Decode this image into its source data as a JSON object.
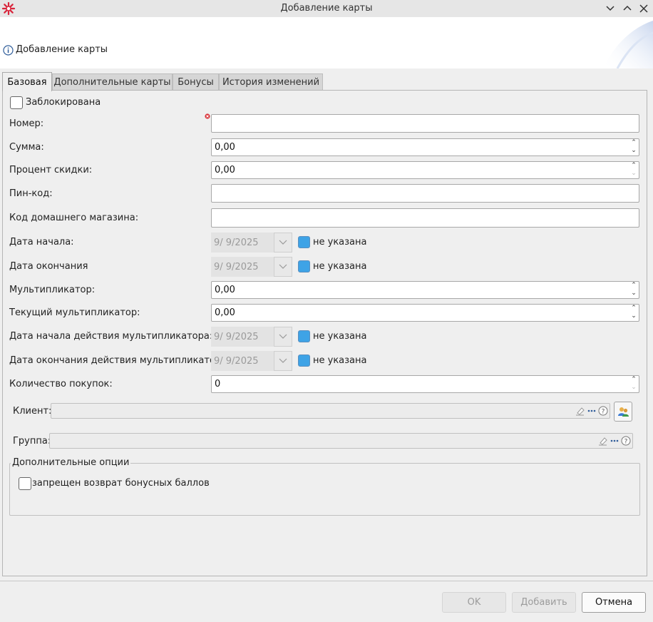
{
  "window": {
    "title": "Добавление карты"
  },
  "header": {
    "title": "Добавление карты"
  },
  "tabs": [
    {
      "label": "Базовая",
      "active": true
    },
    {
      "label": "Дополнительные карты",
      "active": false
    },
    {
      "label": "Бонусы",
      "active": false
    },
    {
      "label": "История изменений",
      "active": false
    }
  ],
  "form": {
    "blocked_label": "Заблокирована",
    "number_label": "Номер:",
    "number_value": "",
    "sum_label": "Сумма:",
    "sum_value": "0,00",
    "discount_label": "Процент скидки:",
    "discount_value": "0,00",
    "pin_label": "Пин-код:",
    "pin_value": "",
    "home_store_label": "Код домашнего магазина:",
    "home_store_value": "",
    "start_date_label": "Дата начала:",
    "start_date_value": "9/ 9/2025",
    "end_date_label": "Дата окончания",
    "end_date_value": "9/ 9/2025",
    "not_specified_label": "не указана",
    "multiplier_label": "Мультипликатор:",
    "multiplier_value": "0,00",
    "current_multiplier_label": "Текущий мультипликатор:",
    "current_multiplier_value": "0,00",
    "mult_start_label": "Дата начала действия мультипликатора:",
    "mult_start_value": "9/ 9/2025",
    "mult_end_label": "Дата окончания действия мультипликатора:",
    "mult_end_value": "9/ 9/2025",
    "purchases_label": "Количество покупок:",
    "purchases_value": "0",
    "client_label": "Клиент:",
    "client_value": "",
    "group_label": "Группа:",
    "group_value": ""
  },
  "options": {
    "title": "Дополнительные опции",
    "no_bonus_return_label": "запрещен возврат бонусных баллов"
  },
  "buttons": {
    "ok": "OK",
    "add": "Добавить",
    "cancel": "Отмена"
  },
  "colors": {
    "accent_checkbox": "#3ea3e6",
    "required_marker": "#d9343a",
    "app_icon": "#d9263c"
  }
}
